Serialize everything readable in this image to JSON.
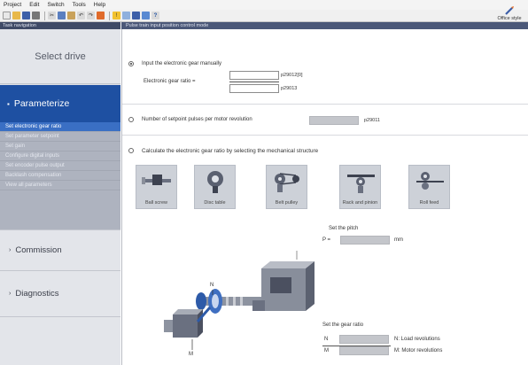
{
  "menu": [
    "Project",
    "Edit",
    "Switch",
    "Tools",
    "Help"
  ],
  "toolbar": {
    "icons": [
      "new-icon",
      "open-icon",
      "save-icon",
      "print-icon",
      "cut-icon",
      "copy-icon",
      "paste-icon",
      "undo-icon",
      "redo-icon",
      "pen-icon",
      "warning-icon",
      "table-icon",
      "monitor-icon",
      "chart-icon",
      "help-icon"
    ],
    "office_button_label": "Office style"
  },
  "header": {
    "left": "Task navigation",
    "right": "Pulse train input position control mode"
  },
  "nav": {
    "select_drive": "Select drive",
    "parameterize": "Parameterize",
    "sub_items": [
      "Set electronic gear ratio",
      "Set parameter setpoint",
      "Set gain",
      "Configure digital inputs",
      "Set encoder pulse output",
      "Backlash compensation",
      "View all parameters"
    ],
    "commission": "Commission",
    "diagnostics": "Diagnostics"
  },
  "main": {
    "option1_label": "Input the electronic gear manually",
    "gear_ratio_label": "Electronic gear ratio =",
    "param_top": "p29012[0]",
    "param_bottom": "p29013",
    "option2_label": "Number of setpoint pulses  per motor revolution",
    "option2_param": "p29011",
    "option3_label": "Calculate the electronic gear ratio by selecting the mechanical structure",
    "mech_items": [
      "Ball screw",
      "Disc table",
      "Belt pulley",
      "Rack and pinion",
      "Roll feed"
    ],
    "pitch_title": "Set the pitch",
    "pitch_prefix": "P =",
    "pitch_unit": "mm",
    "gear_title": "Set the gear ratio",
    "load_prefix": "N",
    "motor_prefix": "M",
    "load_revolutions": "N: Load revolutions",
    "motor_revolutions": "M: Motor revolutions",
    "diagram_labels": {
      "load": "N",
      "motor": "M"
    }
  },
  "colors": {
    "nav_active": "#1e50a2",
    "nav_sub": "#aeb3bf",
    "header": "#3f4a66"
  }
}
